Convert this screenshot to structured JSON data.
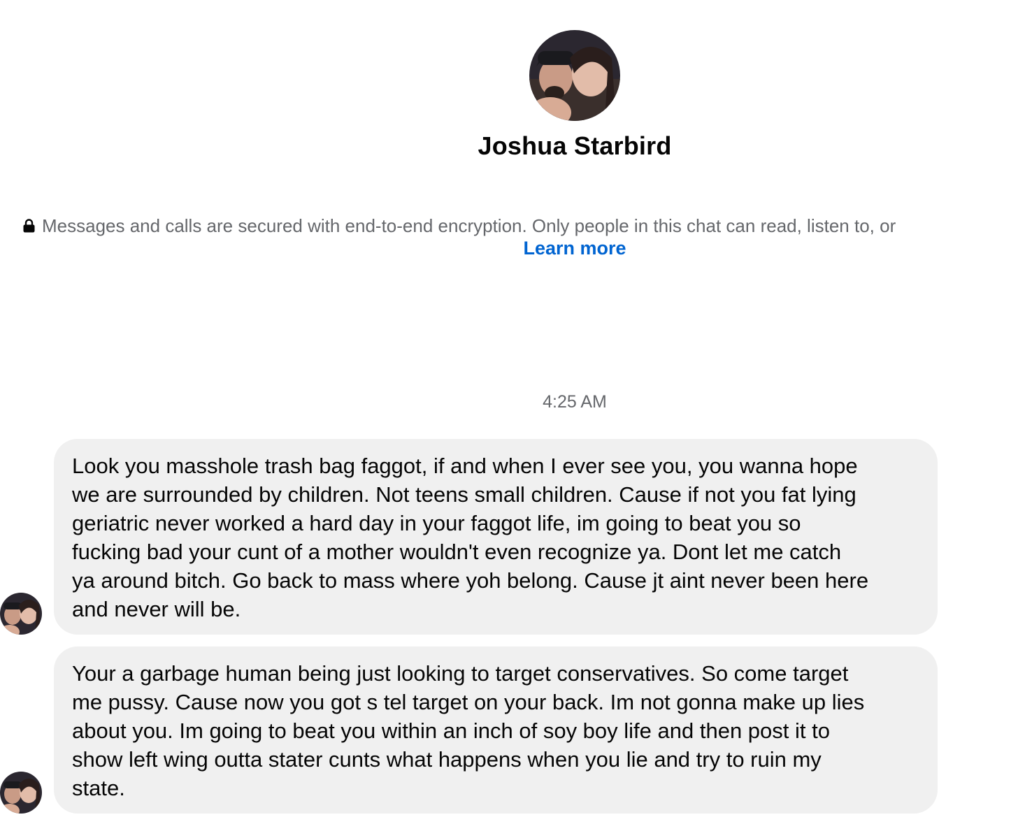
{
  "contact": {
    "name": "Joshua Starbird",
    "avatar": "profile-photo-couple"
  },
  "encryption": {
    "icon": "lock-icon",
    "text": "Messages and calls are secured with end-to-end encryption. Only people in this chat can read, listen to, or",
    "link": "Learn more"
  },
  "conversation": {
    "timestamp": "4:25 AM",
    "messages": [
      {
        "text": "Look you masshole trash bag faggot, if and when I ever see you, you wanna hope\nwe are surrounded by children. Not teens small children. Cause if not you fat lying\ngeriatric never worked a hard day in your faggot life, im going to beat you so\nfucking bad your cunt of a mother wouldn't even recognize ya. Dont let me catch\nya around bitch. Go back to mass where yoh belong. Cause jt aint never been here\nand never will be."
      },
      {
        "text": "Your a garbage human being just looking to target conservatives. So come target\nme pussy. Cause now you got s tel target on your back. Im not gonna make up lies\nabout you. Im going to beat you within an inch of soy boy life and then post it to\nshow left wing outta stater cunts what happens when you lie and try to ruin my\nstate."
      }
    ]
  },
  "colors": {
    "bubble": "#f0f0f0",
    "link": "#0064d1",
    "muted": "#65676b"
  }
}
